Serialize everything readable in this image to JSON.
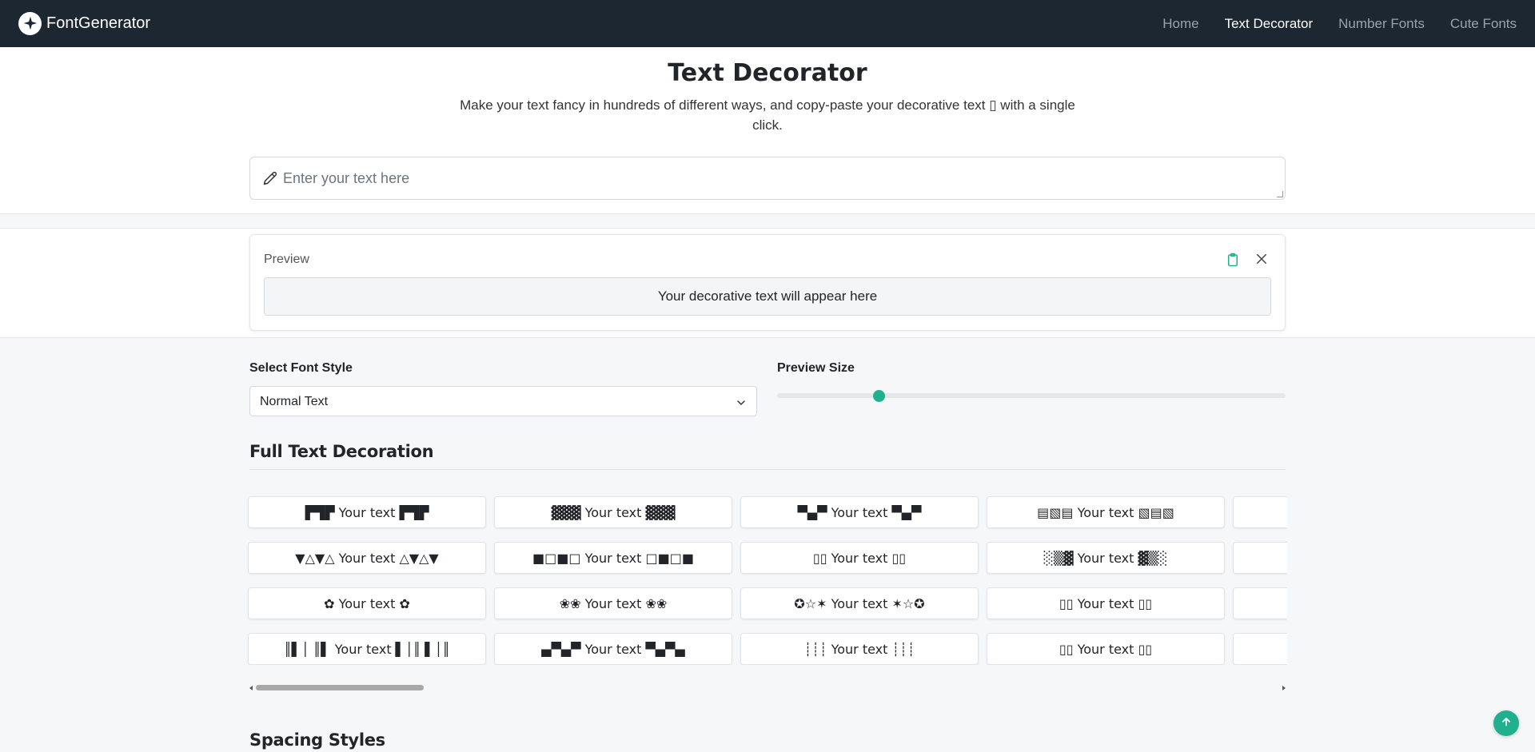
{
  "nav": {
    "brand": "FontGenerator",
    "links": [
      {
        "label": "Home"
      },
      {
        "label": "Text Decorator"
      },
      {
        "label": "Number Fonts"
      },
      {
        "label": "Cute Fonts"
      }
    ],
    "active_index": 1
  },
  "header": {
    "title": "Text Decorator",
    "subtitle": "Make your text fancy in hundreds of different ways, and copy-paste your decorative text ▯ with a single click.",
    "input_placeholder": "Enter your text here",
    "input_value": ""
  },
  "preview": {
    "label": "Preview",
    "placeholder": "Your decorative text will appear here"
  },
  "controls": {
    "font_style_label": "Select Font Style",
    "font_style_value": "Normal Text",
    "preview_size_label": "Preview Size",
    "preview_size_fraction": 0.2
  },
  "sections": {
    "full": "Full Text Decoration",
    "spacing": "Spacing Styles"
  },
  "decorations": [
    [
      "▛▜▛ Your text ▛▜▛",
      "▓▓▓ Your text ▓▓▓",
      "▀▄▀ Your text ▀▄▀",
      "▤▧▤ Your text ▧▤▧",
      ""
    ],
    [
      "▼△▼△ Your text △▼△▼",
      "■□■□ Your text □■□■",
      "▯▯ Your text ▯▯",
      "░▒▓ Your text ▓▒░",
      ""
    ],
    [
      "✿ Your text ✿",
      "❀❀ Your text ❀❀",
      "✪☆✶ Your text ✶☆✪",
      "▯▯ Your text ▯▯",
      ""
    ],
    [
      "║▌│ ║▌ Your text ▌│║ ▌│║",
      "▄▀▄▀ Your text ▀▄▀▄",
      "┊┊┊ Your text ┊┊┊",
      "▯▯ Your text ▯▯",
      ""
    ]
  ],
  "colors": {
    "navbar_bg": "#1c2731",
    "accent": "#20b08e"
  }
}
